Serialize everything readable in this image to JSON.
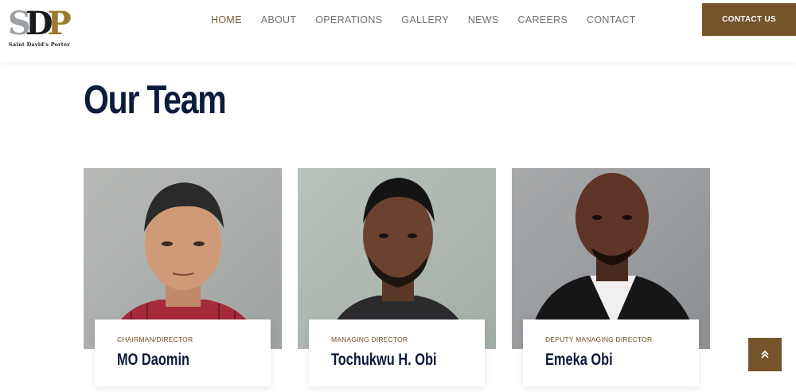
{
  "brand": {
    "logo_letters": [
      "S",
      "D",
      "P"
    ],
    "logo_subtitle": "Saint David's Porter",
    "colors": {
      "gold": "#9a7a2c",
      "grey": "#9ba0a5",
      "dark": "#1a1a1a"
    }
  },
  "nav": {
    "items": [
      {
        "label": "HOME",
        "active": true
      },
      {
        "label": "ABOUT"
      },
      {
        "label": "OPERATIONS"
      },
      {
        "label": "GALLERY"
      },
      {
        "label": "NEWS"
      },
      {
        "label": "CAREERS"
      },
      {
        "label": "CONTACT"
      }
    ],
    "cta_label": "CONTACT US"
  },
  "section": {
    "title": "Our Team"
  },
  "team": [
    {
      "role": "CHAIRMAN/DIRECTOR",
      "name": "MO Daomin"
    },
    {
      "role": "MANAGING DIRECTOR",
      "name": "Tochukwu H. Obi"
    },
    {
      "role": "DEPUTY MANAGING DIRECTOR",
      "name": "Emeka Obi"
    }
  ],
  "scroll_top": {
    "icon": "double-chevron-up-icon",
    "glyph": "⌃"
  },
  "colors": {
    "accent": "#75542c",
    "heading": "#0c1a3d",
    "nav_text": "#6f7177"
  }
}
